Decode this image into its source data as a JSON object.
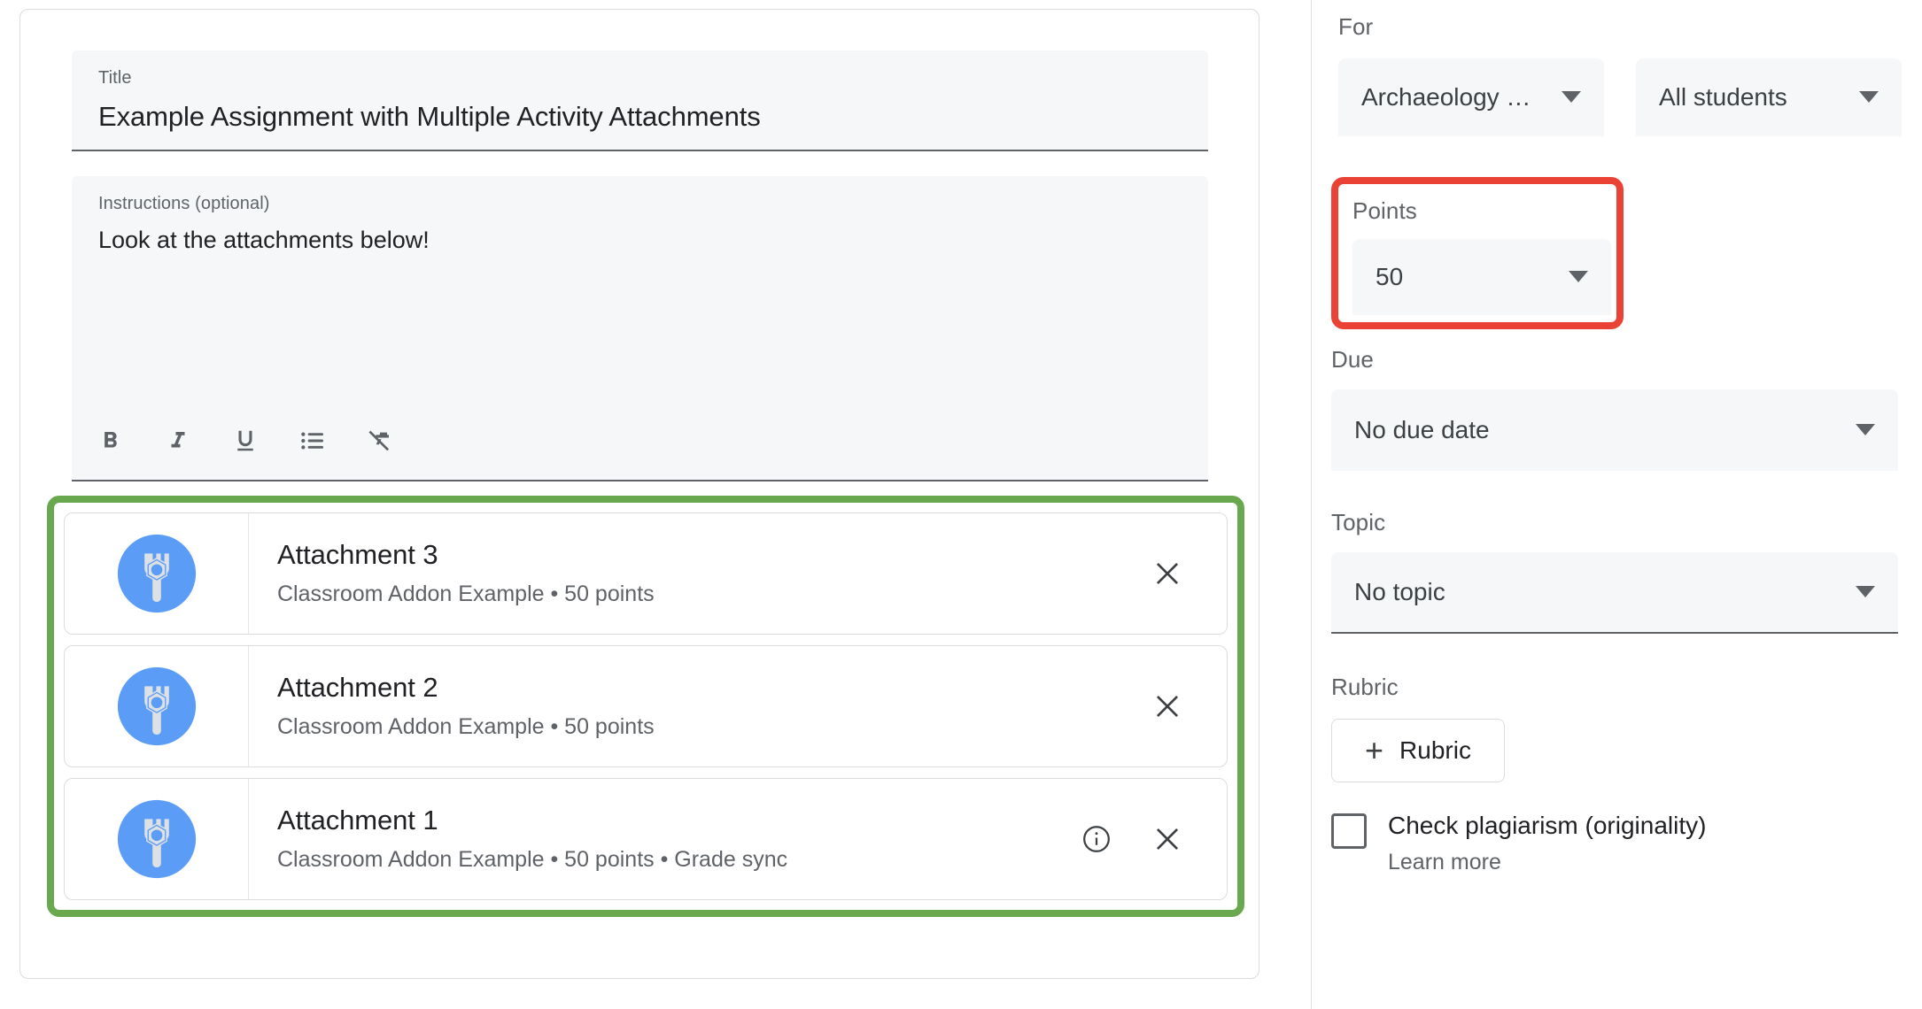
{
  "editor": {
    "title_field": {
      "label": "Title",
      "value": "Example Assignment with Multiple Activity Attachments"
    },
    "instructions_field": {
      "label": "Instructions (optional)",
      "value": "Look at the attachments below!"
    },
    "rte_toolbar": {
      "bold": "bold-icon",
      "italic": "italic-icon",
      "underline": "underline-icon",
      "bulleted_list": "bulleted-list-icon",
      "clear_formatting": "clear-formatting-icon"
    },
    "attachments_highlight_color": "#6aa84f",
    "attachments": [
      {
        "icon": "classroom-addon-icon",
        "title": "Attachment 3",
        "subtitle": "Classroom Addon Example • 50 points",
        "has_info": false,
        "close_label": "Remove attachment"
      },
      {
        "icon": "classroom-addon-icon",
        "title": "Attachment 2",
        "subtitle": "Classroom Addon Example • 50 points",
        "has_info": false,
        "close_label": "Remove attachment"
      },
      {
        "icon": "classroom-addon-icon",
        "title": "Attachment 1",
        "subtitle": "Classroom Addon Example • 50 points • Grade sync",
        "has_info": true,
        "close_label": "Remove attachment"
      }
    ]
  },
  "settings": {
    "for": {
      "label": "For",
      "course_value": "Archaeology …",
      "students_value": "All students"
    },
    "points": {
      "label": "Points",
      "value": "50",
      "highlight_color": "#ea4335"
    },
    "due": {
      "label": "Due",
      "value": "No due date"
    },
    "topic": {
      "label": "Topic",
      "value": "No topic"
    },
    "rubric": {
      "label": "Rubric",
      "button_plus": "+",
      "button_label": "Rubric"
    },
    "plagiarism": {
      "checkbox_label": "Check plagiarism (originality)",
      "learn_more": "Learn more",
      "checked": false
    }
  }
}
